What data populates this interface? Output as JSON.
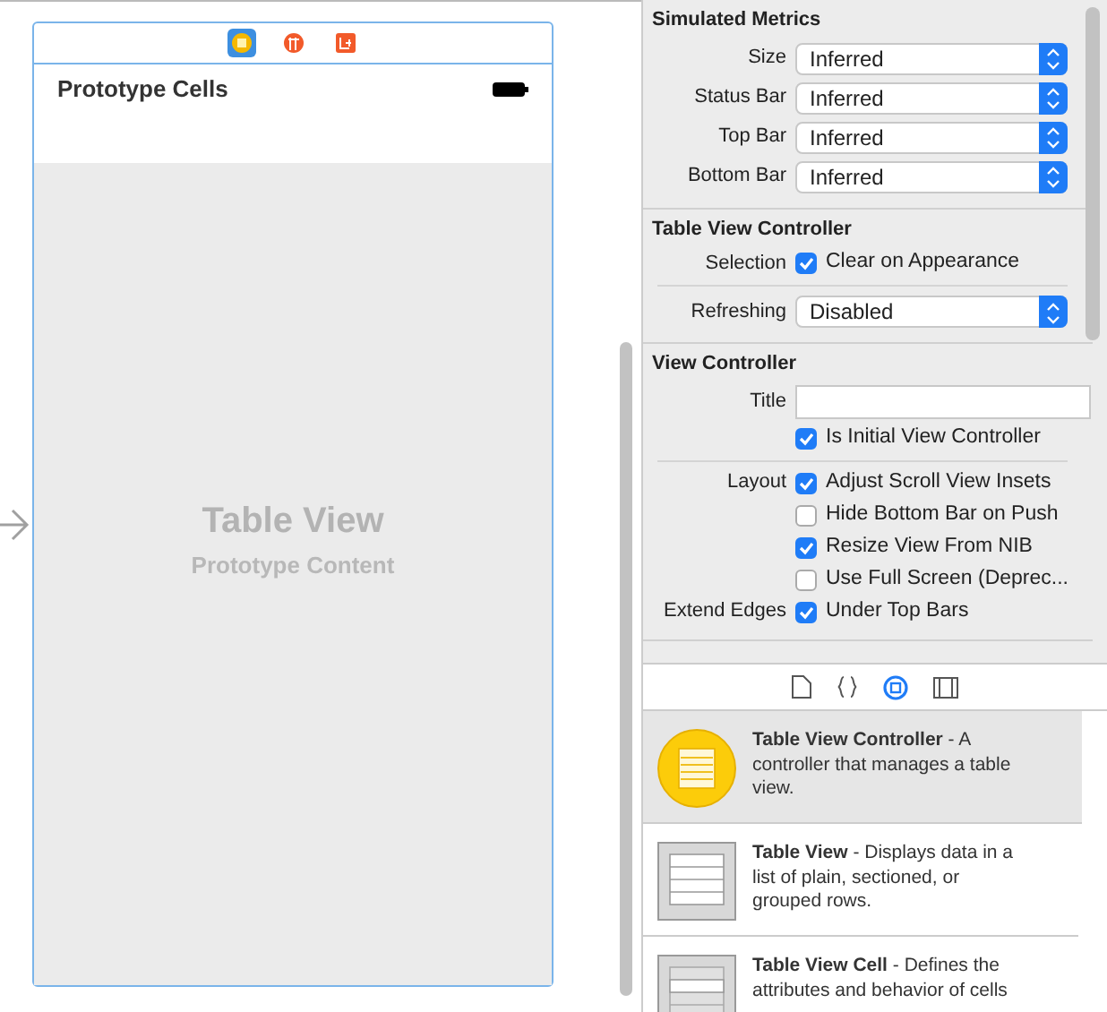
{
  "scene": {
    "dock": [
      {
        "selected": true
      },
      {
        "selected": false
      },
      {
        "selected": false
      }
    ],
    "nav_title": "Prototype Cells",
    "table_title": "Table View",
    "table_subtitle": "Prototype Content"
  },
  "inspector": {
    "sections": [
      {
        "title": "Simulated Metrics",
        "rows": [
          {
            "kind": "select",
            "label": "Size",
            "value": "Inferred"
          },
          {
            "kind": "select",
            "label": "Status Bar",
            "value": "Inferred"
          },
          {
            "kind": "select",
            "label": "Top Bar",
            "value": "Inferred"
          },
          {
            "kind": "select",
            "label": "Bottom Bar",
            "value": "Inferred"
          }
        ]
      },
      {
        "title": "Table View Controller",
        "rows": [
          {
            "kind": "checkbox",
            "label": "Selection",
            "text": "Clear on Appearance",
            "checked": true
          },
          {
            "kind": "divider"
          },
          {
            "kind": "select",
            "label": "Refreshing",
            "value": "Disabled"
          }
        ]
      },
      {
        "title": "View Controller",
        "rows": [
          {
            "kind": "text",
            "label": "Title",
            "value": ""
          },
          {
            "kind": "checkbox",
            "text": "Is Initial View Controller",
            "checked": true
          },
          {
            "kind": "divider"
          },
          {
            "kind": "checkbox",
            "label": "Layout",
            "text": "Adjust Scroll View Insets",
            "checked": true
          },
          {
            "kind": "checkbox",
            "text": "Hide Bottom Bar on Push",
            "checked": false
          },
          {
            "kind": "checkbox",
            "text": "Resize View From NIB",
            "checked": true
          },
          {
            "kind": "checkbox",
            "text": "Use Full Screen (Deprec...",
            "checked": false
          },
          {
            "kind": "checkbox",
            "label": "Extend Edges",
            "text": "Under Top Bars",
            "checked": true
          }
        ]
      }
    ]
  },
  "library_tabs": [
    {
      "kind": "file",
      "selected": false
    },
    {
      "kind": "braces",
      "selected": false
    },
    {
      "kind": "object",
      "selected": true
    },
    {
      "kind": "media",
      "selected": false
    }
  ],
  "library": [
    {
      "kind": "controller",
      "text": "**Table View Controller** - A controller that manages a table view.",
      "selected": true
    },
    {
      "kind": "table",
      "text": "**Table View** - Displays data in a list of plain, sectioned, or grouped rows.",
      "selected": false
    },
    {
      "kind": "cell",
      "text": "**Table View Cell** - Defines the attributes and behavior of cells",
      "selected": false
    }
  ]
}
